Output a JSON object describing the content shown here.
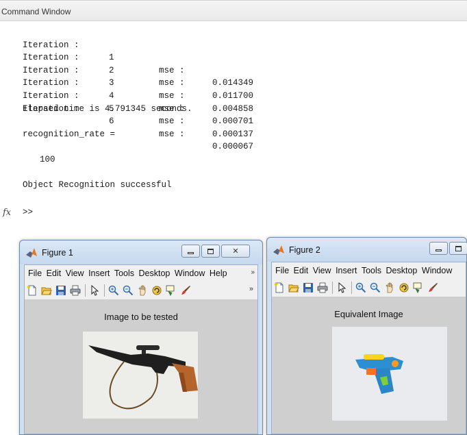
{
  "command_window": {
    "title": "Command Window",
    "iterations": [
      {
        "label": "Iteration :",
        "num": "1",
        "mse_label": "mse :",
        "mse": "0.014349"
      },
      {
        "label": "Iteration :",
        "num": "2",
        "mse_label": "mse :",
        "mse": "0.011700"
      },
      {
        "label": "Iteration :",
        "num": "3",
        "mse_label": "mse :",
        "mse": "0.004858"
      },
      {
        "label": "Iteration :",
        "num": "4",
        "mse_label": "mse :",
        "mse": "0.000701"
      },
      {
        "label": "Iteration :",
        "num": "5",
        "mse_label": "mse :",
        "mse": "0.000137"
      },
      {
        "label": "Iteration :",
        "num": "6",
        "mse_label": "mse :",
        "mse": "0.000067"
      }
    ],
    "elapsed": "Elapsed time is 4.791345 seconds.",
    "var_line": "recognition_rate =",
    "var_value": "100",
    "result": "Object Recognition successful",
    "fx_symbol": "fx",
    "prompt": ">>"
  },
  "figure1": {
    "title": "Figure 1",
    "menus": [
      "File",
      "Edit",
      "View",
      "Insert",
      "Tools",
      "Desktop",
      "Window",
      "Help"
    ],
    "menu_more": "»",
    "toolbar_more": "»",
    "axes_title": "Image to be tested",
    "image": "rifle-toy-photo"
  },
  "figure2": {
    "title": "Figure 2",
    "menus": [
      "File",
      "Edit",
      "View",
      "Insert",
      "Tools",
      "Desktop",
      "Window"
    ],
    "axes_title": "Equivalent Image",
    "image": "water-gun-toy-photo"
  },
  "toolbar_icons": [
    "new-figure-icon",
    "open-file-icon",
    "save-icon",
    "print-icon",
    "arrow-icon",
    "zoom-in-icon",
    "zoom-out-icon",
    "pan-icon",
    "rotate-icon",
    "data-cursor-icon",
    "brush-icon"
  ],
  "colors": {
    "accent_title": "#c5d8ee",
    "figure_bg": "#cfcfcf",
    "matlab_orange": "#e87722"
  }
}
